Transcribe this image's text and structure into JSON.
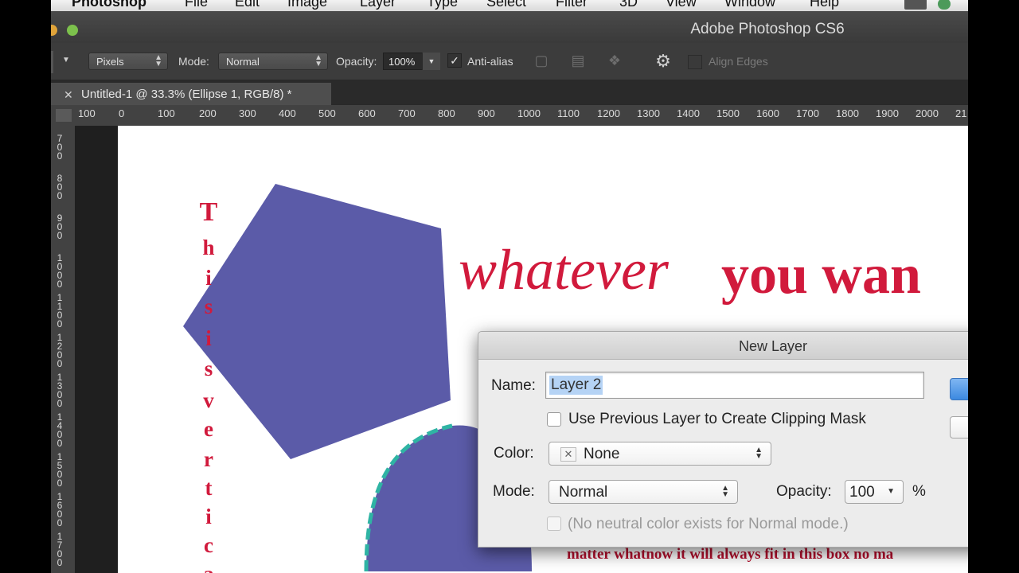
{
  "menubar": {
    "app_name": "Photoshop",
    "items": [
      "File",
      "Edit",
      "Image",
      "Layer",
      "Type",
      "Select",
      "Filter",
      "3D",
      "View",
      "Window",
      "Help"
    ]
  },
  "window": {
    "title": "Adobe Photoshop CS6"
  },
  "options_bar": {
    "units": "Pixels",
    "mode_label": "Mode:",
    "mode_value": "Normal",
    "opacity_label": "Opacity:",
    "opacity_value": "100%",
    "antialias_label": "Anti-alias",
    "antialias_checked": true,
    "align_edges_label": "Align Edges"
  },
  "document_tab": {
    "title": "Untitled-1 @ 33.3% (Ellipse 1, RGB/8) *"
  },
  "rulers": {
    "horizontal": [
      "100",
      "0",
      "100",
      "200",
      "300",
      "400",
      "500",
      "600",
      "700",
      "800",
      "900",
      "1000",
      "1100",
      "1200",
      "1300",
      "1400",
      "1500",
      "1600",
      "1700",
      "1800",
      "1900",
      "2000",
      "21"
    ],
    "vertical": [
      "700",
      "800",
      "900",
      "1000",
      "1100",
      "1200",
      "1300",
      "1400",
      "1500",
      "1600",
      "1700"
    ]
  },
  "canvas": {
    "vertical_text": [
      "T",
      "h",
      "i",
      "s",
      "i",
      "s",
      "v",
      "e",
      "r",
      "t",
      "i",
      "c",
      "a"
    ],
    "headline_italic": "whatever",
    "headline_bold": "you wan",
    "box_text": "matter whatnow it will always fit in this box no ma",
    "colors": {
      "shape_fill": "#5b5ba8",
      "text_red": "#d11a3c",
      "selection_teal": "#2fb4a4"
    }
  },
  "dialog": {
    "title": "New Layer",
    "name_label": "Name:",
    "name_value": "Layer 2",
    "clipping_mask_label": "Use Previous Layer to Create Clipping Mask",
    "clipping_mask_checked": false,
    "color_label": "Color:",
    "color_value": "None",
    "mode_label": "Mode:",
    "mode_value": "Normal",
    "opacity_label": "Opacity:",
    "opacity_value": "100",
    "opacity_unit": "%",
    "neutral_label": "(No neutral color exists for Normal mode.)",
    "neutral_checked": false
  }
}
